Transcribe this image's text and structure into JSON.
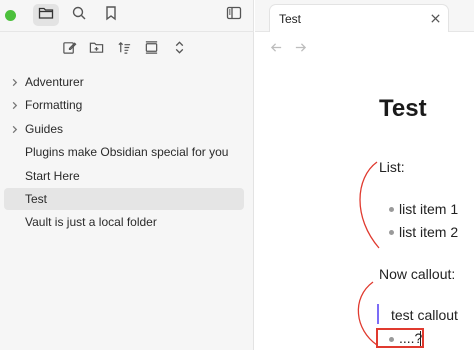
{
  "sidebar": {
    "topbar": {
      "icons": [
        "files-icon",
        "search-icon",
        "bookmark-icon",
        "sidebar-toggle-icon"
      ]
    },
    "navtools": {
      "icons": [
        "new-note-icon",
        "new-folder-icon",
        "sort-icon",
        "collapse-icon",
        "expand-all-icon"
      ]
    },
    "items": [
      {
        "label": "Adventurer",
        "type": "folder"
      },
      {
        "label": "Formatting",
        "type": "folder"
      },
      {
        "label": "Guides",
        "type": "folder"
      },
      {
        "label": "Plugins make Obsidian special for you",
        "type": "file"
      },
      {
        "label": "Start Here",
        "type": "file"
      },
      {
        "label": "Test",
        "type": "file",
        "active": true
      },
      {
        "label": "Vault is just a local folder",
        "type": "file"
      }
    ]
  },
  "tab": {
    "title": "Test"
  },
  "document": {
    "title": "Test",
    "list_heading": "List:",
    "list_items": [
      "list item 1",
      "list item 2"
    ],
    "callout_heading": "Now callout:",
    "callout_text": "test callout",
    "callout_bullet": "....?"
  },
  "colors": {
    "accent": "#7b6cf6",
    "annotation": "#e03a2f",
    "status_dot": "#4cc03c"
  }
}
